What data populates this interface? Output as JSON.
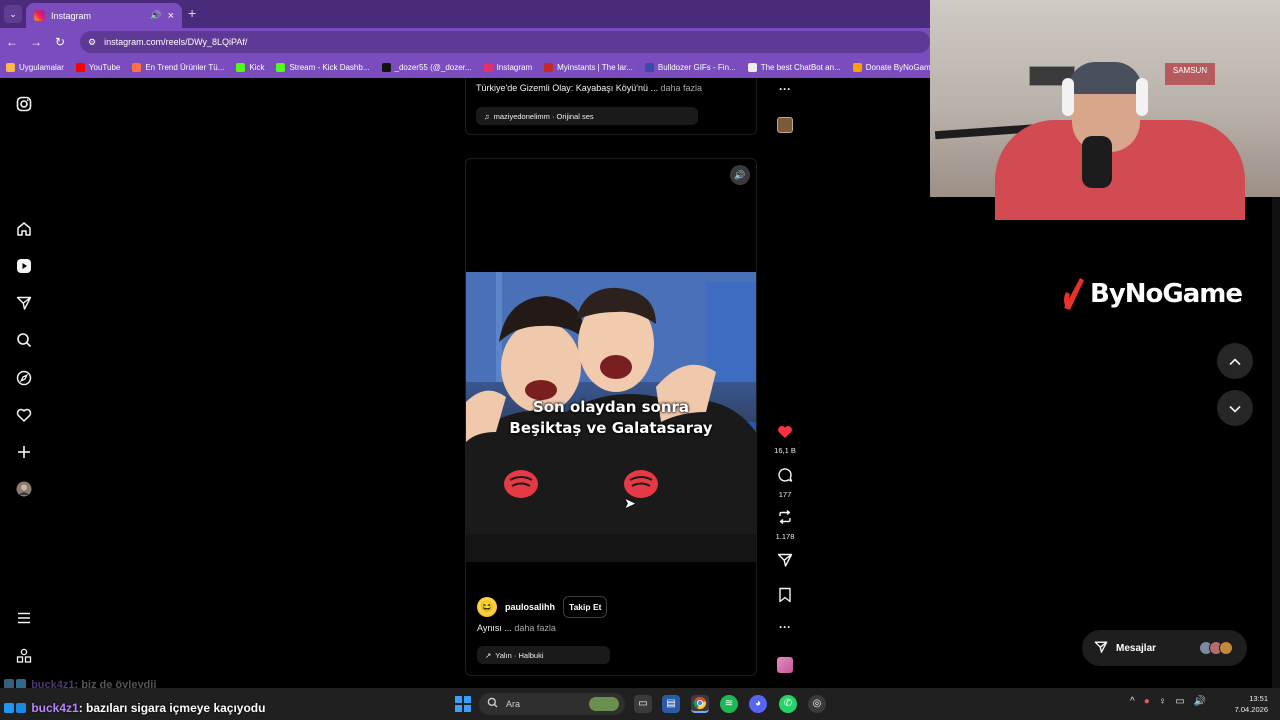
{
  "browser": {
    "tab_title": "Instagram",
    "tab_mute_icon": "speaker-icon",
    "url": "instagram.com/reels/DWy_8LQiPAf/",
    "bookmarks": [
      {
        "label": "Uygulamalar",
        "color": "#ffb74d"
      },
      {
        "label": "YouTube",
        "color": "#ff0000"
      },
      {
        "label": "En Trend Ürünler Tü...",
        "color": "#ff7043"
      },
      {
        "label": "Kick",
        "color": "#53fc18"
      },
      {
        "label": "Stream - Kick Dashb...",
        "color": "#53fc18"
      },
      {
        "label": "_dozer55 (@_dozer...",
        "color": "#111111"
      },
      {
        "label": "Instagram",
        "color": "#e1306c"
      },
      {
        "label": "Myinstants | The lar...",
        "color": "#c62828"
      },
      {
        "label": "Bulldozer GIFs - Fin...",
        "color": "#3949ab"
      },
      {
        "label": "The best ChatBot an...",
        "color": "#eeeeee"
      },
      {
        "label": "Donate ByNoGam",
        "color": "#ffa000"
      }
    ]
  },
  "previous_reel": {
    "caption": "Türkiye'de Gizemli Olay: Kayabaşı Köyü'nü ...",
    "more": "daha fazla",
    "audio": "maziyedonelimm · Orijinal ses"
  },
  "reel": {
    "overlay_line1": "Son olaydan sonra",
    "overlay_line2": "Beşiktaş ve Galatasaray",
    "author": "paulosalihh",
    "follow_label": "Takip Et",
    "caption": "Aynısı ...",
    "more": "daha fazla",
    "audio": "Yalın · Halbuki",
    "likes": "16,1 B",
    "comments": "177",
    "reposts": "1.178",
    "like_color": "#ff3040"
  },
  "overlay": {
    "brand": "ByNoGame",
    "brand_color": "#e5322d",
    "cam_sign": "SAMSUN",
    "messages_label": "Mesajlar"
  },
  "chat": [
    {
      "user": "buck4z1",
      "text": ": biz de öyleydij"
    },
    {
      "user": "buck4z1",
      "text": ": bazıları sigara içmeye kaçıyodu"
    }
  ],
  "taskbar": {
    "search_placeholder": "Ara",
    "time": "13:51",
    "date": "7.04.2026"
  }
}
